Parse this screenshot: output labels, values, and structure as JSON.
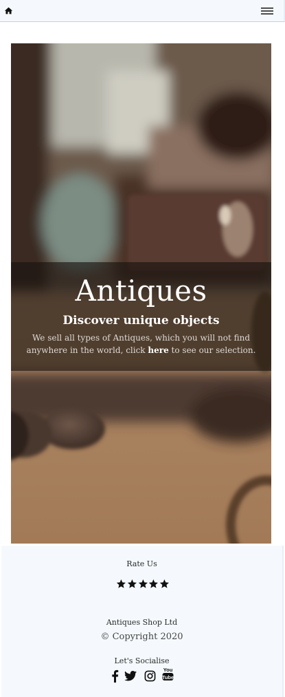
{
  "navbar": {
    "home_icon": "home-icon",
    "menu_icon": "hamburger-menu-icon"
  },
  "hero": {
    "title": "Antiques",
    "subtitle": "Discover unique objects",
    "text_before": "We sell all types of Antiques, which you will not find anywhere in the world, click ",
    "link_text": "here",
    "text_after": " to see our selection."
  },
  "footer": {
    "rate_label": "Rate Us",
    "rating": 5,
    "rating_max": 5,
    "company": "Antiques Shop Ltd",
    "copyright": "© Copyright 2020",
    "socialise_label": "Let's Socialise",
    "social_icons": [
      "facebook-icon",
      "twitter-icon",
      "instagram-icon",
      "youtube-icon"
    ]
  },
  "colors": {
    "navbar_bg": "#f5f9fd",
    "footer_bg": "#f5f9fd",
    "band_overlay": "#16110f"
  }
}
